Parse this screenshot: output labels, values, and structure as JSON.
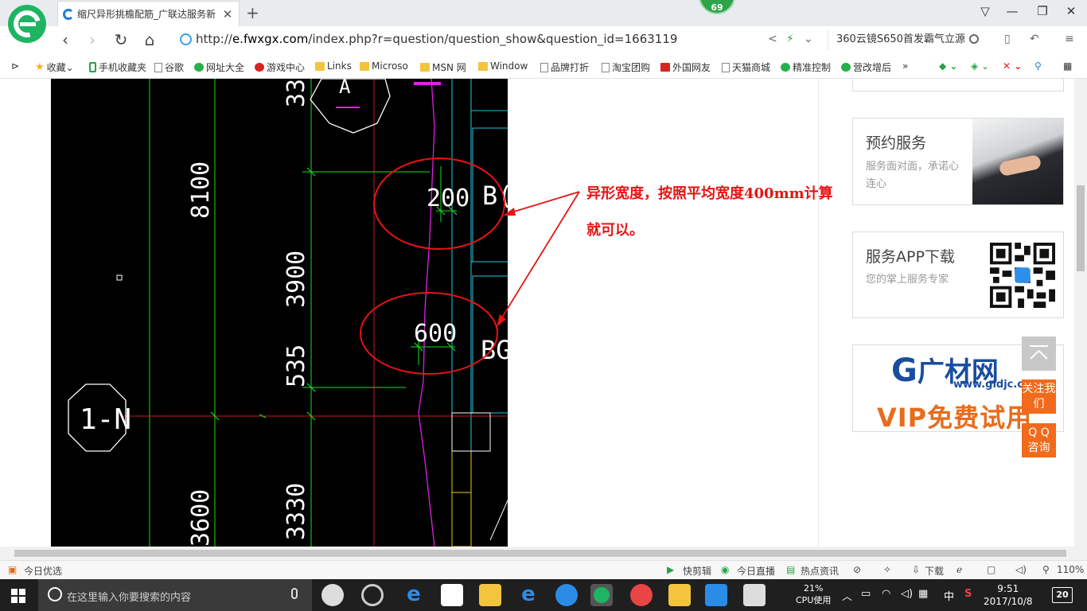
{
  "browser": {
    "tab_title": "缩尺异形挑檐配筋_广联达服务新",
    "badge": "69",
    "url_host": "e.fwxgx.com",
    "url_path": "/index.php?r=question/question_show&question_id=1663119",
    "url_prefix": "http://",
    "search_text": "360云镜S650首发霸气立源"
  },
  "bookmarks": [
    {
      "label": "收藏",
      "icon": "star-icon"
    },
    {
      "label": "手机收藏夹",
      "icon": "phone-icon"
    },
    {
      "label": "谷歌",
      "icon": "page-icon"
    },
    {
      "label": "网址大全",
      "icon": "site-nav-icon"
    },
    {
      "label": "游戏中心",
      "icon": "game-icon"
    },
    {
      "label": "Links",
      "icon": "folder-icon"
    },
    {
      "label": "Microso",
      "icon": "folder-icon"
    },
    {
      "label": "MSN 网",
      "icon": "folder-icon"
    },
    {
      "label": "Window",
      "icon": "folder-icon"
    },
    {
      "label": "品牌打折",
      "icon": "page-icon"
    },
    {
      "label": "淘宝团购",
      "icon": "page-icon"
    },
    {
      "label": "外国网友",
      "icon": "flag-icon"
    },
    {
      "label": "天猫商城",
      "icon": "page-icon"
    },
    {
      "label": "精准控制",
      "icon": "wechat-icon"
    },
    {
      "label": "营改增后",
      "icon": "wechat-icon"
    }
  ],
  "cad": {
    "dim_8100": "8100",
    "dim_3900": "3900",
    "dim_535": "535",
    "dim_3330": "3330",
    "dim_3600": "3600",
    "dim_33": "33",
    "width_200": "200",
    "width_600": "600",
    "label_bg": "BG",
    "label_b": "B(",
    "axis_label": "1-N",
    "circle_label": "A"
  },
  "annotation": {
    "line1": "异形宽度，按照平均宽度400mm计算",
    "line2": "就可以。"
  },
  "sidebar": {
    "booking_title": "预约服务",
    "booking_sub": "服务面对面，承诺心连心",
    "app_title": "服务APP下载",
    "app_sub": "您的掌上服务专家",
    "gcai_name": "广材网",
    "gcai_url": "www.gldjc.com",
    "gcai_vip": "VIP免费试用"
  },
  "floating": {
    "follow": "关注我们",
    "qq": "Q Q 咨询"
  },
  "statusbar": {
    "left": "今日优选",
    "kuaijianji": "快剪辑",
    "live": "今日直播",
    "news": "热点资讯",
    "download": "下载",
    "zoom": "110%"
  },
  "taskbar": {
    "search_placeholder": "在这里输入你要搜索的内容",
    "cpu_percent": "21%",
    "cpu_label": "CPU使用",
    "ime": "中",
    "time": "9:51",
    "date": "2017/10/8",
    "notifications": "20"
  },
  "colors": {
    "annotation_red": "#e81313",
    "cad_green": "#18e018",
    "cad_magenta": "#e020e0",
    "cad_cyan": "#20c8e0",
    "browser_green": "#1fb462",
    "float_orange": "#f26a1b"
  }
}
